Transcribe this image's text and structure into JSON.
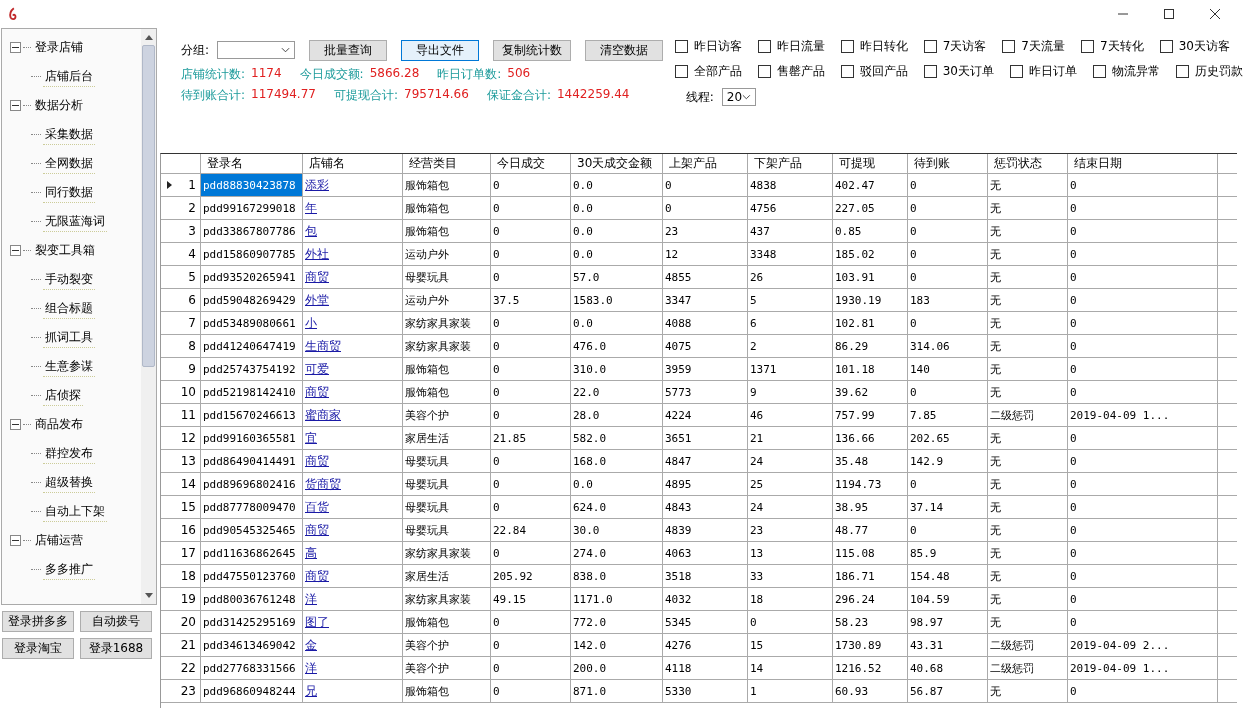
{
  "sidebar": {
    "tree": [
      {
        "label": "登录店铺",
        "expanded": true,
        "children": [
          {
            "label": "店铺后台"
          }
        ]
      },
      {
        "label": "数据分析",
        "expanded": true,
        "children": [
          {
            "label": "采集数据"
          },
          {
            "label": "全网数据"
          },
          {
            "label": "同行数据"
          },
          {
            "label": "无限蓝海词"
          }
        ]
      },
      {
        "label": "裂变工具箱",
        "expanded": true,
        "children": [
          {
            "label": "手动裂变"
          },
          {
            "label": "组合标题"
          },
          {
            "label": "抓词工具"
          },
          {
            "label": "生意参谋"
          },
          {
            "label": "店侦探"
          }
        ]
      },
      {
        "label": "商品发布",
        "expanded": true,
        "children": [
          {
            "label": "群控发布"
          },
          {
            "label": "超级替换"
          },
          {
            "label": "自动上下架"
          }
        ]
      },
      {
        "label": "店铺运营",
        "expanded": true,
        "children": [
          {
            "label": "多多推广"
          }
        ]
      }
    ],
    "buttons": [
      "登录拼多多",
      "自动拨号",
      "登录淘宝",
      "登录1688"
    ]
  },
  "toolbar": {
    "group_label": "分组:",
    "buttons": [
      {
        "label": "批量查询",
        "selected": false
      },
      {
        "label": "导出文件",
        "selected": true
      },
      {
        "label": "复制统计数",
        "selected": false
      },
      {
        "label": "清空数据",
        "selected": false
      }
    ],
    "stats": [
      [
        {
          "label": "店铺统计数:",
          "value": "1174"
        },
        {
          "label": "今日成交额:",
          "value": "5866.28"
        },
        {
          "label": "昨日订单数:",
          "value": "506"
        }
      ],
      [
        {
          "label": "待到账合计:",
          "value": "117494.77"
        },
        {
          "label": "可提现合计:",
          "value": "795714.66"
        },
        {
          "label": "保证金合计:",
          "value": "1442259.44"
        }
      ]
    ],
    "filters": [
      [
        {
          "label": "昨日访客",
          "checked": false
        },
        {
          "label": "昨日流量",
          "checked": false
        },
        {
          "label": "昨日转化",
          "checked": false
        },
        {
          "label": "7天访客",
          "checked": false
        },
        {
          "label": "7天流量",
          "checked": false
        },
        {
          "label": "7天转化",
          "checked": false
        },
        {
          "label": "30天访客",
          "checked": false
        }
      ],
      [
        {
          "label": "全部产品",
          "checked": false
        },
        {
          "label": "售罄产品",
          "checked": false
        },
        {
          "label": "驳回产品",
          "checked": false
        },
        {
          "label": "30天订单",
          "checked": false
        },
        {
          "label": "昨日订单",
          "checked": false
        },
        {
          "label": "物流异常",
          "checked": false
        },
        {
          "label": "历史罚款",
          "checked": false
        }
      ]
    ],
    "threads_label": "线程:",
    "threads_value": "20"
  },
  "table": {
    "columns": [
      "登录名",
      "店铺名",
      "经营类目",
      "今日成交",
      "30天成交金额",
      "上架产品",
      "下架产品",
      "可提现",
      "待到账",
      "惩罚状态",
      "结束日期"
    ],
    "rows": [
      {
        "num": "1",
        "selected": true,
        "cells": [
          "pdd88830423878",
          "添彩",
          "服饰箱包",
          "0",
          "0.0",
          "0",
          "4838",
          "402.47",
          "0",
          "无",
          "0"
        ]
      },
      {
        "num": "2",
        "selected": false,
        "cells": [
          "pdd99167299018",
          "年",
          "服饰箱包",
          "0",
          "0.0",
          "0",
          "4756",
          "227.05",
          "0",
          "无",
          "0"
        ]
      },
      {
        "num": "3",
        "selected": false,
        "cells": [
          "pdd33867807786",
          "包",
          "服饰箱包",
          "0",
          "0.0",
          "23",
          "437",
          "0.85",
          "0",
          "无",
          "0"
        ]
      },
      {
        "num": "4",
        "selected": false,
        "cells": [
          "pdd15860907785",
          "外社",
          "运动户外",
          "0",
          "0.0",
          "12",
          "3348",
          "185.02",
          "0",
          "无",
          "0"
        ]
      },
      {
        "num": "5",
        "selected": false,
        "cells": [
          "pdd93520265941",
          "商贸",
          "母婴玩具",
          "0",
          "57.0",
          "4855",
          "26",
          "103.91",
          "0",
          "无",
          "0"
        ]
      },
      {
        "num": "6",
        "selected": false,
        "cells": [
          "pdd59048269429",
          "外堂",
          "运动户外",
          "37.5",
          "1583.0",
          "3347",
          "5",
          "1930.19",
          "183",
          "无",
          "0"
        ]
      },
      {
        "num": "7",
        "selected": false,
        "cells": [
          "pdd53489080661",
          "小",
          "家纺家具家装",
          "0",
          "0.0",
          "4088",
          "6",
          "102.81",
          "0",
          "无",
          "0"
        ]
      },
      {
        "num": "8",
        "selected": false,
        "cells": [
          "pdd41240647419",
          "生商贸",
          "家纺家具家装",
          "0",
          "476.0",
          "4075",
          "2",
          "86.29",
          "314.06",
          "无",
          "0"
        ]
      },
      {
        "num": "9",
        "selected": false,
        "cells": [
          "pdd25743754192",
          "可爱",
          "服饰箱包",
          "0",
          "310.0",
          "3959",
          "1371",
          "101.18",
          "140",
          "无",
          "0"
        ]
      },
      {
        "num": "10",
        "selected": false,
        "cells": [
          "pdd52198142410",
          "商贸",
          "服饰箱包",
          "0",
          "22.0",
          "5773",
          "9",
          "39.62",
          "0",
          "无",
          "0"
        ]
      },
      {
        "num": "11",
        "selected": false,
        "cells": [
          "pdd15670246613",
          "蜜商家",
          "美容个护",
          "0",
          "28.0",
          "4224",
          "46",
          "757.99",
          "7.85",
          "二级惩罚",
          "2019-04-09 1..."
        ]
      },
      {
        "num": "12",
        "selected": false,
        "cells": [
          "pdd99160365581",
          "宜",
          "家居生活",
          "21.85",
          "582.0",
          "3651",
          "21",
          "136.66",
          "202.65",
          "无",
          "0"
        ]
      },
      {
        "num": "13",
        "selected": false,
        "cells": [
          "pdd86490414491",
          "商贸",
          "母婴玩具",
          "0",
          "168.0",
          "4847",
          "24",
          "35.48",
          "142.9",
          "无",
          "0"
        ]
      },
      {
        "num": "14",
        "selected": false,
        "cells": [
          "pdd89696802416",
          "货商贸",
          "母婴玩具",
          "0",
          "0.0",
          "4895",
          "25",
          "1194.73",
          "0",
          "无",
          "0"
        ]
      },
      {
        "num": "15",
        "selected": false,
        "cells": [
          "pdd87778009470",
          "百货",
          "母婴玩具",
          "0",
          "624.0",
          "4843",
          "24",
          "38.95",
          "37.14",
          "无",
          "0"
        ]
      },
      {
        "num": "16",
        "selected": false,
        "cells": [
          "pdd90545325465",
          "商贸",
          "母婴玩具",
          "22.84",
          "30.0",
          "4839",
          "23",
          "48.77",
          "0",
          "无",
          "0"
        ]
      },
      {
        "num": "17",
        "selected": false,
        "cells": [
          "pdd11636862645",
          "高",
          "家纺家具家装",
          "0",
          "274.0",
          "4063",
          "13",
          "115.08",
          "85.9",
          "无",
          "0"
        ]
      },
      {
        "num": "18",
        "selected": false,
        "cells": [
          "pdd47550123760",
          "商贸",
          "家居生活",
          "205.92",
          "838.0",
          "3518",
          "33",
          "186.71",
          "154.48",
          "无",
          "0"
        ]
      },
      {
        "num": "19",
        "selected": false,
        "cells": [
          "pdd80036761248",
          "洋",
          "家纺家具家装",
          "49.15",
          "1171.0",
          "4032",
          "18",
          "296.24",
          "104.59",
          "无",
          "0"
        ]
      },
      {
        "num": "20",
        "selected": false,
        "cells": [
          "pdd31425295169",
          "图了",
          "服饰箱包",
          "0",
          "772.0",
          "5345",
          "0",
          "58.23",
          "98.97",
          "无",
          "0"
        ]
      },
      {
        "num": "21",
        "selected": false,
        "cells": [
          "pdd34613469042",
          "金",
          "美容个护",
          "0",
          "142.0",
          "4276",
          "15",
          "1730.89",
          "43.31",
          "二级惩罚",
          "2019-04-09 2..."
        ]
      },
      {
        "num": "22",
        "selected": false,
        "cells": [
          "pdd27768331566",
          "洋",
          "美容个护",
          "0",
          "200.0",
          "4118",
          "14",
          "1216.52",
          "40.68",
          "二级惩罚",
          "2019-04-09 1..."
        ]
      },
      {
        "num": "23",
        "selected": false,
        "cells": [
          "pdd96860948244",
          "兄",
          "服饰箱包",
          "0",
          "871.0",
          "5330",
          "1",
          "60.93",
          "56.87",
          "无",
          "0"
        ]
      }
    ]
  }
}
